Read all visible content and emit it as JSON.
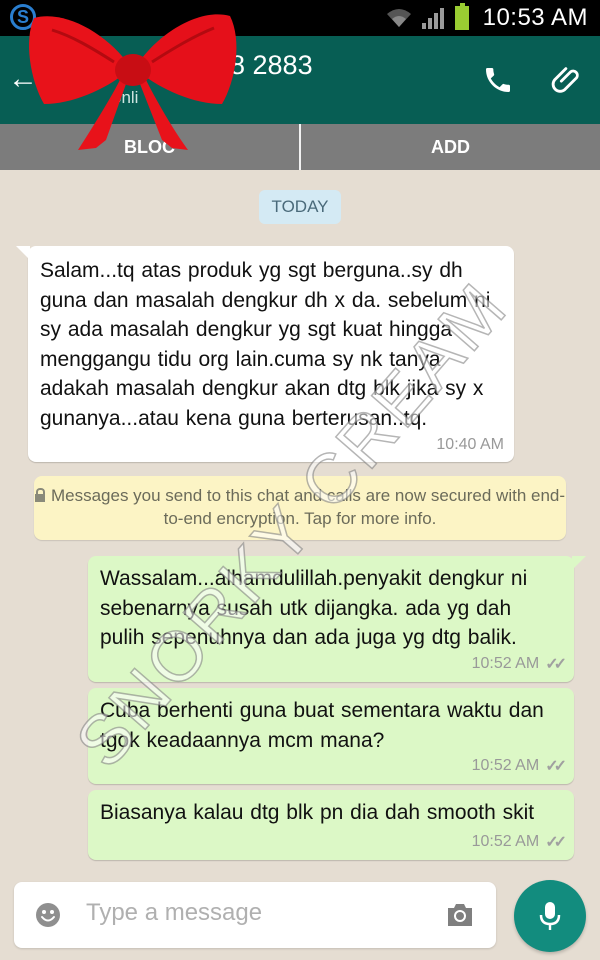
{
  "status_bar": {
    "time": "10:53 AM",
    "left_icon": "skype-icon"
  },
  "header": {
    "contact_name": "8 2883",
    "contact_status": "onli",
    "call_icon": "phone-icon",
    "attach_icon": "paperclip-icon"
  },
  "actions": {
    "block_label": "BLOC",
    "add_label": "ADD"
  },
  "chat": {
    "date_label": "TODAY",
    "incoming": {
      "text": "Salam...tq atas produk yg sgt berguna..sy dh guna dan masalah dengkur dh x da. sebelum ni sy ada masalah dengkur yg sgt kuat hingga menggangu tidu org lain.cuma sy nk tanya adakah masalah dengkur akan dtg blk jika sy x gunanya...atau kena guna berterusan..tq.",
      "time": "10:40 AM"
    },
    "encryption_notice": "Messages you send to this chat and calls are now secured with end-to-end encryption. Tap for more info.",
    "outgoing": [
      {
        "text": "Wassalam...alhamdulillah.penyakit dengkur ni sebenarnya susah utk dijangka. ada yg dah pulih sepenuhnya dan ada juga yg dtg balik.",
        "time": "10:52 AM"
      },
      {
        "text": "Cuba berhenti guna buat sementara waktu dan tgok keadaannya mcm mana?",
        "time": "10:52 AM"
      },
      {
        "text": "Biasanya kalau dtg blk pn dia dah smooth skit",
        "time": "10:52 AM"
      }
    ],
    "watermark": "SNORKY CREAM"
  },
  "input": {
    "placeholder": "Type a message"
  },
  "colors": {
    "header": "#075e54",
    "outgoing_bubble": "#dcf8c6",
    "mic_button": "#128c7e",
    "ribbon": "#e8121a"
  }
}
